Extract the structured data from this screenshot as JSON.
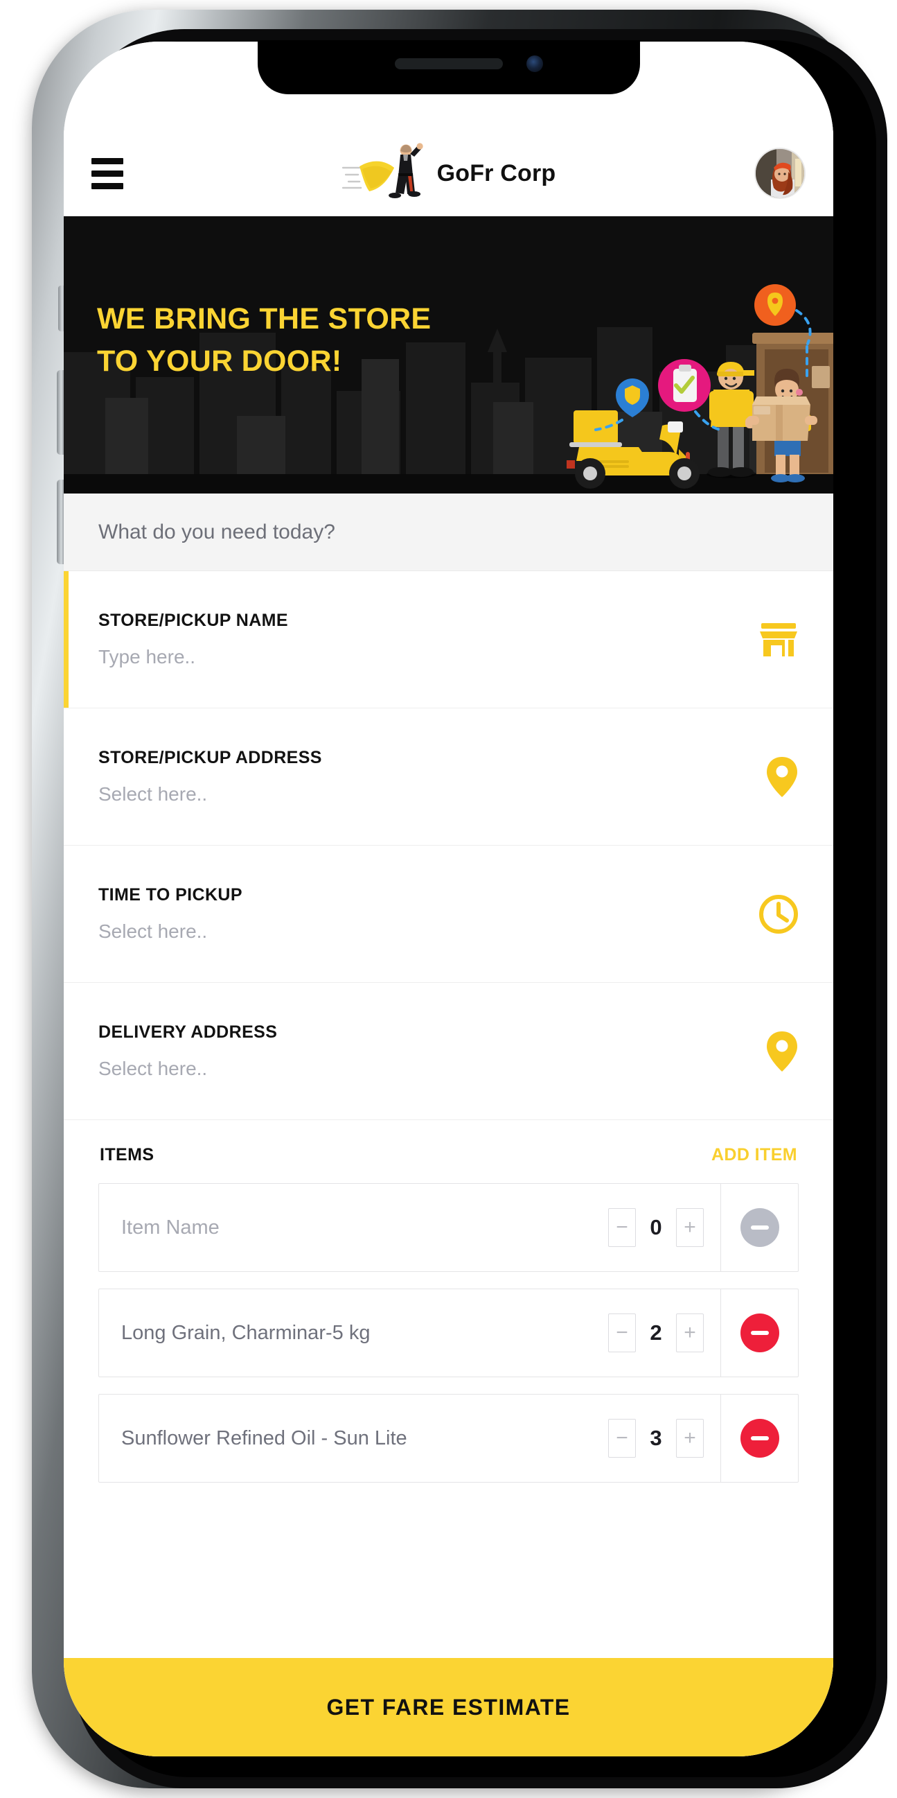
{
  "header": {
    "menu_icon": "hamburger-menu-icon",
    "brand_logo_icon": "superhero-running-logo-icon",
    "brand_name": "GoFr Corp",
    "avatar_icon": "user-avatar"
  },
  "hero": {
    "line1": "WE BRING THE STORE",
    "line2": "TO YOUR DOOR!",
    "illustration_icon": "delivery-scooter-handoff-illustration",
    "background_color": "#0e0e0e",
    "text_color": "#FBD433"
  },
  "prompt": {
    "text": "What do you need today?"
  },
  "fields": [
    {
      "label": "STORE/PICKUP NAME",
      "value": "Type here..",
      "icon": "store-icon",
      "active": true
    },
    {
      "label": "STORE/PICKUP ADDRESS",
      "value": "Select here..",
      "icon": "map-pin-icon",
      "active": false
    },
    {
      "label": "TIME TO PICKUP",
      "value": "Select here..",
      "icon": "clock-icon",
      "active": false
    },
    {
      "label": "DELIVERY ADDRESS",
      "value": "Select here..",
      "icon": "map-pin-icon",
      "active": false
    }
  ],
  "items_section": {
    "title": "ITEMS",
    "add_label": "ADD ITEM",
    "decrement_label": "−",
    "increment_label": "+",
    "rows": [
      {
        "name": "Item Name",
        "is_placeholder": true,
        "qty": "0",
        "remove_enabled": false
      },
      {
        "name": "Long Grain, Charminar-5 kg",
        "is_placeholder": false,
        "qty": "2",
        "remove_enabled": true
      },
      {
        "name": "Sunflower Refined Oil - Sun Lite",
        "is_placeholder": false,
        "qty": "3",
        "remove_enabled": true
      }
    ]
  },
  "cta": {
    "label": "GET FARE ESTIMATE",
    "background_color": "#FBD433"
  },
  "colors": {
    "accent_yellow": "#FBD433",
    "danger_red": "#EE1F3A",
    "disabled_gray": "#b9bcc6",
    "dark": "#0e0e0e"
  }
}
